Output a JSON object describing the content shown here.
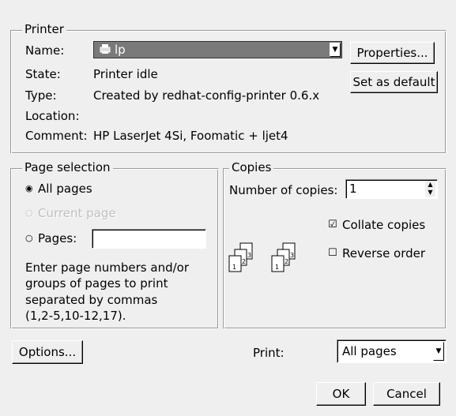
{
  "printer": {
    "group_title": "Printer",
    "name_label": "Name:",
    "name_value": "lp",
    "printer_icon": "printer-icon",
    "properties_button": "Properties...",
    "set_default_button": "Set as default",
    "state_label": "State:",
    "state_value": "Printer idle",
    "type_label": "Type:",
    "type_value": "Created by redhat-config-printer 0.6.x",
    "location_label": "Location:",
    "location_value": "",
    "comment_label": "Comment:",
    "comment_value": "HP LaserJet 4Si, Foomatic + ljet4"
  },
  "page_selection": {
    "group_title": "Page selection",
    "all_pages_label": "All pages",
    "all_pages_selected": true,
    "current_page_label": "Current page",
    "current_page_enabled": false,
    "pages_label": "Pages:",
    "pages_value": "",
    "help_line1": "Enter page numbers and/or",
    "help_line2": "groups of pages to print",
    "help_line3": "separated by commas",
    "help_line4": "(1,2-5,10-12,17)."
  },
  "copies": {
    "group_title": "Copies",
    "number_label": "Number of copies:",
    "number_value": "1",
    "collate_label": "Collate copies",
    "collate_checked": true,
    "reverse_label": "Reverse order",
    "reverse_checked": false,
    "page_numbers": [
      "1",
      "2",
      "3"
    ]
  },
  "bottom": {
    "options_button": "Options...",
    "print_label": "Print:",
    "print_selected": "All pages",
    "ok_button": "OK",
    "cancel_button": "Cancel"
  },
  "colors": {
    "background": "#efefef",
    "selection": "#7a7a7a"
  }
}
